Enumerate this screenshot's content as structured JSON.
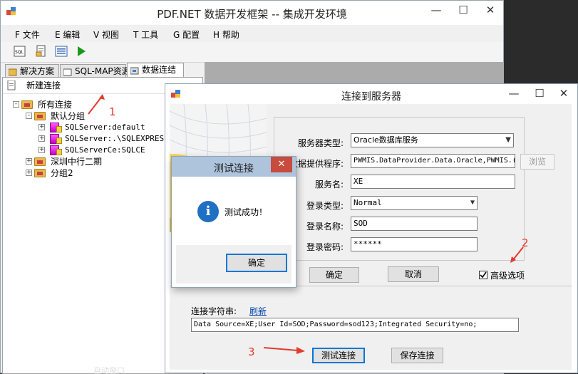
{
  "main": {
    "title": "PDF.NET 数据开发框架 -- 集成开发环境",
    "menu": [
      "F 文件",
      "E 编辑",
      "V 视图",
      "T 工具",
      "G 配置",
      "H 帮助"
    ],
    "tabs": [
      "解决方案",
      "SQL-MAP资源",
      "数据连结"
    ],
    "new_connection": "新建连接",
    "tree": {
      "root": "所有连接",
      "group_default": "默认分组",
      "conn1": "SQLServer:default",
      "conn2": "SQLServer:.\\SQLEXPRESS",
      "conn3": "SQLServerCe:SQLCE",
      "group2": "深圳中行二期",
      "group3": "分组2"
    },
    "bottom_text": "自动窗口"
  },
  "connect_dialog": {
    "title": "连接到服务器",
    "server_type_label": "服务器类型:",
    "server_type_value": "Oracle数据库服务",
    "provider_label": "数据提供程序:",
    "provider_value": "PWMIS.DataProvider.Data.Oracle,PWMIS.(",
    "browse_button": "浏览",
    "service_label": "服务名:",
    "service_value": "XE",
    "login_type_label": "登录类型:",
    "login_type_value": "Normal",
    "login_name_label": "登录名称:",
    "login_name_value": "SOD",
    "password_label": "登录密码:",
    "password_value": "******",
    "ok_button": "确定",
    "cancel_button": "取消",
    "advanced_label": "高级选项",
    "conn_string_label": "连接字符串:",
    "refresh_link": "刷新",
    "conn_string_value": "Data Source=XE;User Id=SOD;Password=sod123;Integrated Security=no;",
    "test_button": "测试连接",
    "save_button": "保存连接"
  },
  "test_dialog": {
    "title": "测试连接",
    "message": "测试成功！",
    "ok_button": "确定"
  },
  "annotations": [
    "1",
    "2",
    "3"
  ],
  "colors": {
    "annotation": "#e23a2c",
    "link": "#0645ad",
    "info_icon": "#1f6fc3",
    "close": "#c84b3c"
  }
}
